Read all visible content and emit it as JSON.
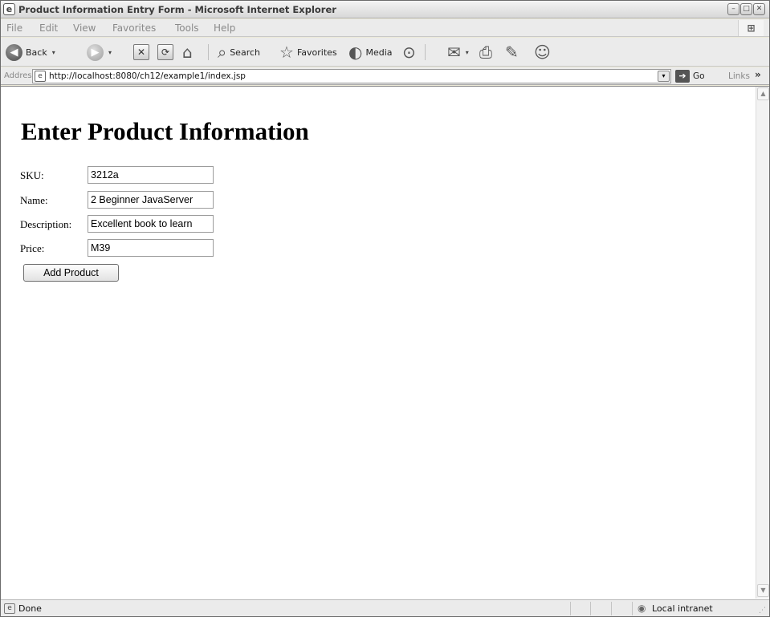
{
  "window": {
    "title": "Product Information Entry Form - Microsoft Internet Explorer",
    "app_icon": "e",
    "min_glyph": "–",
    "max_glyph": "□",
    "close_glyph": "✕"
  },
  "menu": {
    "items": [
      "File",
      "Edit",
      "View",
      "Favorites",
      "Tools",
      "Help"
    ],
    "logo_glyph": "⊞"
  },
  "toolbar": {
    "back_label": "Back",
    "search_label": "Search",
    "favorites_label": "Favorites",
    "media_label": "Media",
    "icons": {
      "back": "◀",
      "forward": "▶",
      "stop": "✕",
      "refresh": "⟳",
      "home": "⌂",
      "search": "⌕",
      "favorites": "☆",
      "media": "◐",
      "history": "⊙",
      "mail": "✉",
      "print": "⎙",
      "edit": "✎",
      "messenger": "☺",
      "dropdown": "▾"
    }
  },
  "address_bar": {
    "label": "Address",
    "url": "http://localhost:8080/ch12/example1/index.jsp",
    "go_label": "Go",
    "links_label": "Links",
    "page_icon": "e",
    "dropdown_glyph": "▾",
    "go_glyph": "➔",
    "links_chevron": "»"
  },
  "page": {
    "heading": "Enter Product Information",
    "fields": [
      {
        "label": "SKU:",
        "value": "3212a"
      },
      {
        "label": "Name:",
        "value": "2 Beginner JavaServer"
      },
      {
        "label": "Description:",
        "value": "Excellent book to learn"
      },
      {
        "label": "Price:",
        "value": "M39"
      }
    ],
    "submit_label": "Add Product"
  },
  "scrollbar": {
    "up_glyph": "▲",
    "down_glyph": "▼"
  },
  "status_bar": {
    "text": "Done",
    "page_icon": "e",
    "zone": "Local intranet",
    "zone_icon": "◉",
    "grip": "⋰"
  }
}
